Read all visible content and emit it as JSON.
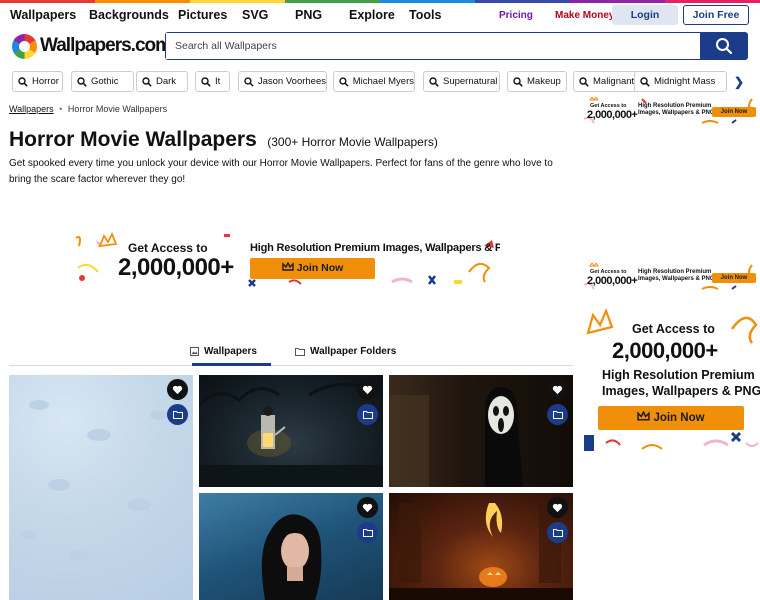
{
  "colors": {
    "brand": "#1b3c8a",
    "accent": "#f0900a",
    "stripe": [
      "#e53935",
      "#fb8c00",
      "#fdd835",
      "#43a047",
      "#1e88e5",
      "#3949ab",
      "#8e24aa",
      "#e91e63"
    ]
  },
  "nav": {
    "items": [
      "Wallpapers",
      "Backgrounds",
      "Pictures",
      "SVG",
      "PNG",
      "Explore",
      "Tools"
    ],
    "pricing": "Pricing",
    "make_money": "Make Money",
    "login": "Login",
    "join_free": "Join Free"
  },
  "logo": {
    "text": "Wallpapers.com",
    "icon": "logo-icon"
  },
  "search": {
    "placeholder": "Search all Wallpapers",
    "icon": "search-icon"
  },
  "tags": [
    "Horror",
    "Gothic",
    "Dark",
    "It",
    "Jason Voorhees",
    "Michael Myers",
    "Supernatural",
    "Makeup",
    "Malignant",
    "Midnight Mass"
  ],
  "breadcrumb": {
    "root": "Wallpapers",
    "separator": "•",
    "current": "Horror Movie Wallpapers"
  },
  "page": {
    "title": "Horror Movie Wallpapers",
    "count": "(300+ Horror Movie Wallpapers)",
    "description": "Get spooked every time you unlock your device with our Horror Movie Wallpapers. Perfect for fans of the genre who love to bring the scare factor wherever they go!"
  },
  "ad": {
    "get_access": "Get Access to",
    "number": "2,000,000+",
    "headline": "High Resolution Premium Images, Wallpapers & PNG",
    "headline_l1": "High Resolution Premium",
    "headline_l2": "Images, Wallpapers & PNG",
    "join": "Join Now"
  },
  "tabs": [
    {
      "label": "Wallpapers",
      "active": true
    },
    {
      "label": "Wallpaper Folders",
      "active": false
    }
  ]
}
